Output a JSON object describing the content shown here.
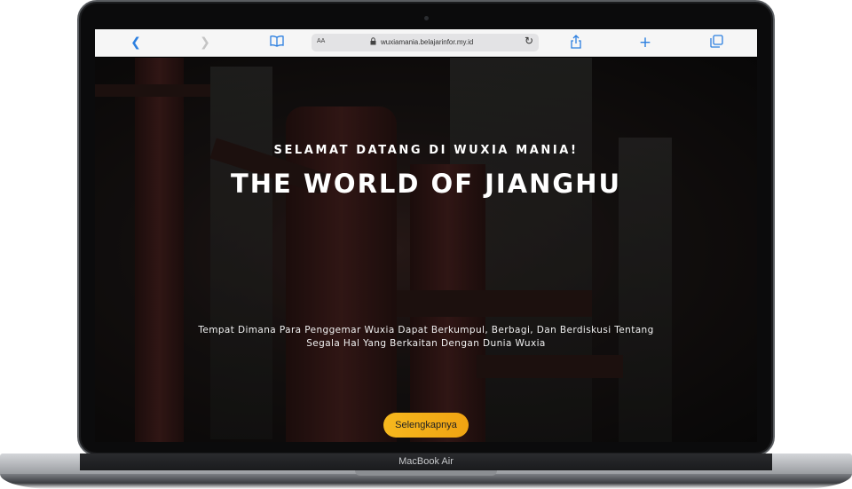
{
  "device": {
    "label": "MacBook Air"
  },
  "browser": {
    "text_size_label": "AA",
    "url": "wuxiamania.belajarinfor.my.id",
    "icons": {
      "back": "chevron-left-icon",
      "forward": "chevron-right-icon",
      "bookmarks": "book-icon",
      "lock": "lock-icon",
      "reload": "reload-icon",
      "share": "share-icon",
      "new_tab": "plus-icon",
      "tabs": "tabs-icon"
    }
  },
  "hero": {
    "greeting": "SELAMAT DATANG DI WUXIA MANIA!",
    "title": "THE WORLD OF JIANGHU",
    "description_line1": "Tempat Dimana Para Penggemar Wuxia Dapat Berkumpul, Berbagi, Dan Berdiskusi Tentang",
    "description_line2": "Segala Hal Yang Berkaitan Dengan Dunia Wuxia",
    "cta_label": "Selengkapnya"
  },
  "colors": {
    "accent": "#f6b81e",
    "toolbar_icon": "#2b7fe0"
  }
}
